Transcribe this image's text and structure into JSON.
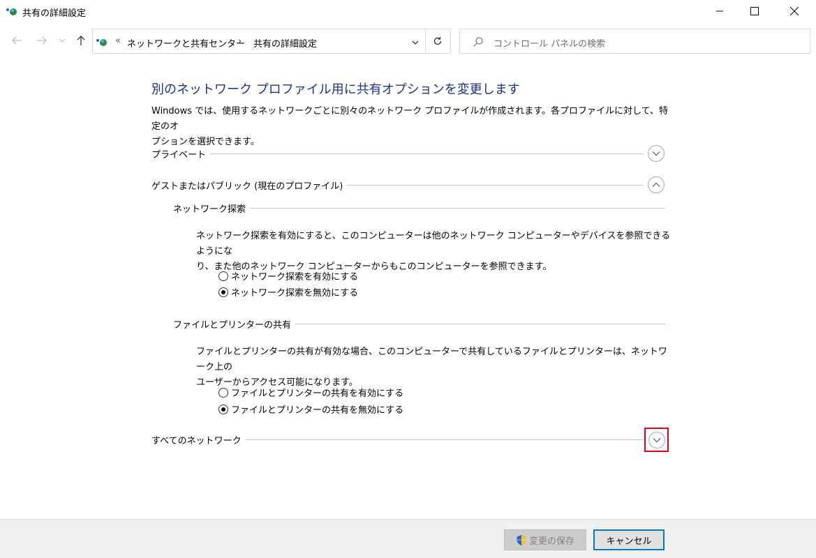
{
  "window": {
    "title": "共有の詳細設定"
  },
  "address_bar": {
    "overflow": "«",
    "crumb_parent": "ネットワークと共有センター",
    "separator": "›",
    "crumb_current": "共有の詳細設定"
  },
  "search": {
    "placeholder": "コントロール パネルの検索"
  },
  "main": {
    "heading": "別のネットワーク プロファイル用に共有オプションを変更します",
    "intro_line1": "Windows では、使用するネットワークごとに別々のネットワーク プロファイルが作成されます。各プロファイルに対して、特定のオ",
    "intro_line2": "プションを選択できます。",
    "profiles": {
      "private": {
        "label": "プライベート",
        "expanded": false
      },
      "guest_public": {
        "label": "ゲストまたはパブリック (現在のプロファイル)",
        "expanded": true
      },
      "all_networks": {
        "label": "すべてのネットワーク",
        "expanded": false
      }
    },
    "discovery": {
      "title": "ネットワーク探索",
      "desc_line1": "ネットワーク探索を有効にすると、このコンピューターは他のネットワーク コンピューターやデバイスを参照できるようにな",
      "desc_line2": "り、また他のネットワーク コンピューターからもこのコンピューターを参照できます。",
      "option_on": "ネットワーク探索を有効にする",
      "option_off": "ネットワーク探索を無効にする",
      "selected": "off"
    },
    "file_sharing": {
      "title": "ファイルとプリンターの共有",
      "desc_line1": "ファイルとプリンターの共有が有効な場合、このコンピューターで共有しているファイルとプリンターは、ネットワーク上の",
      "desc_line2": "ユーザーからアクセス可能になります。",
      "option_on": "ファイルとプリンターの共有を有効にする",
      "option_off": "ファイルとプリンターの共有を無効にする",
      "selected": "off"
    }
  },
  "footer": {
    "save_label": "変更の保存",
    "cancel_label": "キャンセル"
  },
  "colors": {
    "heading": "#1e3287",
    "focus_border": "#0078d7",
    "highlight": "#e60012"
  }
}
